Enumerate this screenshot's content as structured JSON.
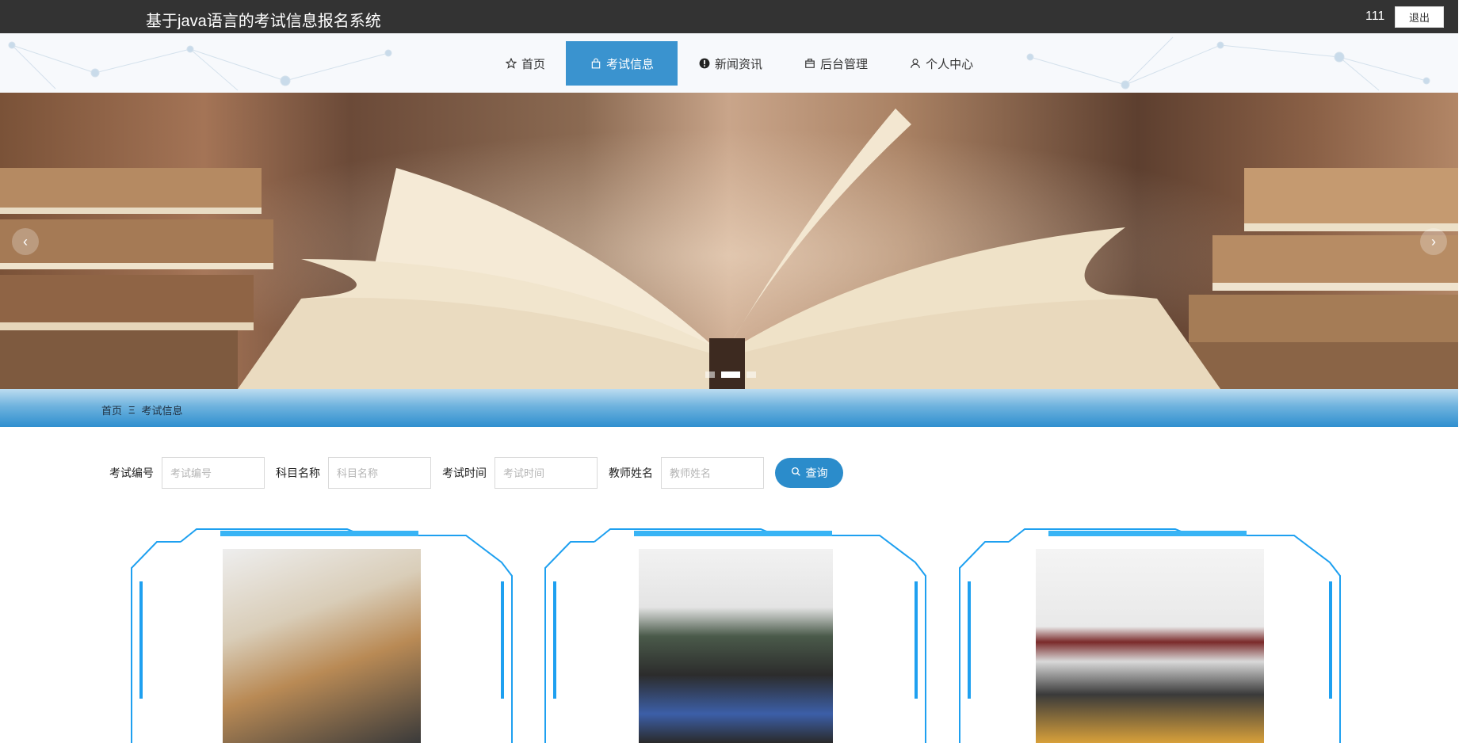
{
  "header": {
    "site_title": "基于java语言的考试信息报名系统",
    "username": "111",
    "logout_label": "退出"
  },
  "nav": {
    "items": [
      {
        "label": "首页",
        "icon": "star-icon"
      },
      {
        "label": "考试信息",
        "icon": "bag-icon"
      },
      {
        "label": "新闻资讯",
        "icon": "info-circle-icon"
      },
      {
        "label": "后台管理",
        "icon": "box-icon"
      },
      {
        "label": "个人中心",
        "icon": "user-icon"
      }
    ],
    "active_index": 1
  },
  "banner": {
    "slide_count": 3,
    "active_slide": 1,
    "prev_label": "‹",
    "next_label": "›"
  },
  "breadcrumb": {
    "home": "首页",
    "separator": "Ξ",
    "current": "考试信息"
  },
  "search": {
    "fields": [
      {
        "label": "考试编号",
        "placeholder": "考试编号"
      },
      {
        "label": "科目名称",
        "placeholder": "科目名称"
      },
      {
        "label": "考试时间",
        "placeholder": "考试时间"
      },
      {
        "label": "教师姓名",
        "placeholder": "教师姓名"
      }
    ],
    "button_label": "查询"
  },
  "colors": {
    "topbar": "#333333",
    "accent": "#3a93cf",
    "button": "#2b8ccb",
    "frame": "#1ea0f0"
  }
}
